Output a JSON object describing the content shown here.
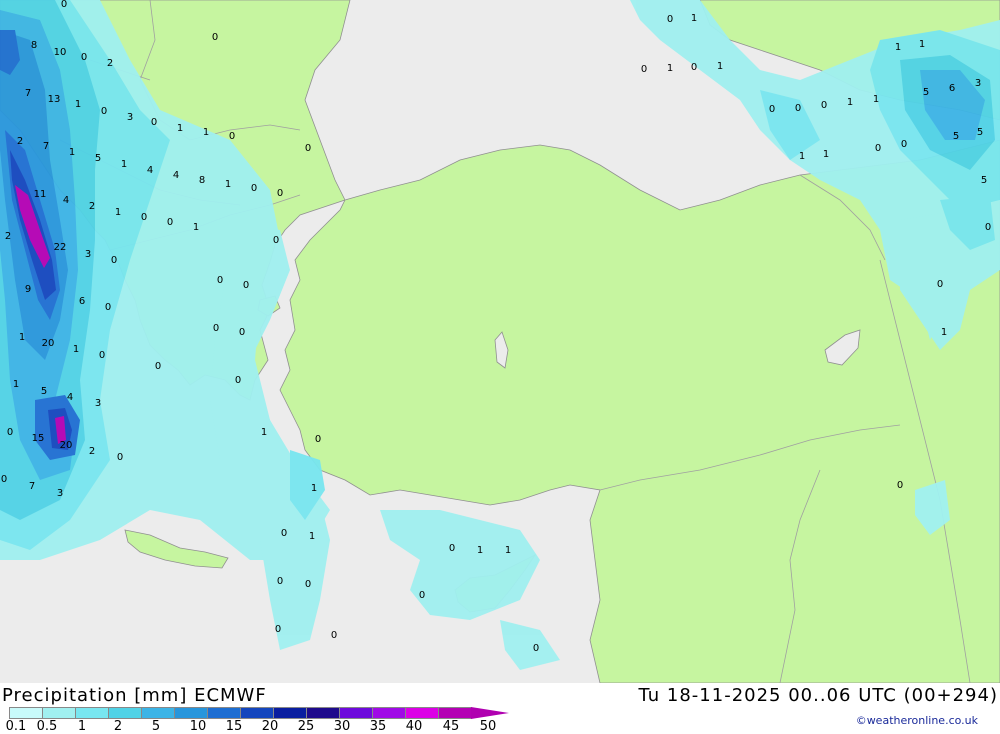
{
  "title_left": "Precipitation [mm] ECMWF",
  "title_right": "Tu 18-11-2025 00..06 UTC (00+294)",
  "credit": "©weatheronline.co.uk",
  "legend": {
    "ticks": [
      "0.1",
      "0.5",
      "1",
      "2",
      "5",
      "10",
      "15",
      "20",
      "25",
      "30",
      "35",
      "40",
      "45",
      "50"
    ],
    "colors": [
      "#c8fafa",
      "#a0f0f0",
      "#78e6f0",
      "#50d2e6",
      "#3cb4e6",
      "#2896dc",
      "#1e6ed2",
      "#1446be",
      "#0a1ea0",
      "#1e0a8c",
      "#6e0adc",
      "#a00ae6",
      "#dc00e6",
      "#b400b4"
    ]
  },
  "colors": {
    "land": "#c6f5a0",
    "sea": "#ececec",
    "border": "#a0a0a0",
    "coast": "#909090"
  },
  "map_values": [
    {
      "t": "0"
    },
    {
      "t": "0"
    },
    {
      "t": "8"
    },
    {
      "t": "10"
    },
    {
      "t": "0"
    },
    {
      "t": "2"
    },
    {
      "t": "7"
    },
    {
      "t": "13"
    },
    {
      "t": "1"
    },
    {
      "t": "0"
    },
    {
      "t": "3"
    },
    {
      "t": "0"
    },
    {
      "t": "1"
    },
    {
      "t": "1"
    },
    {
      "t": "0"
    },
    {
      "t": "2"
    },
    {
      "t": "7"
    },
    {
      "t": "1"
    },
    {
      "t": "5"
    },
    {
      "t": "1"
    },
    {
      "t": "4"
    },
    {
      "t": "4"
    },
    {
      "t": "8"
    },
    {
      "t": "1"
    },
    {
      "t": "0"
    },
    {
      "t": "0"
    },
    {
      "t": "11"
    },
    {
      "t": "4"
    },
    {
      "t": "2"
    },
    {
      "t": "1"
    },
    {
      "t": "0"
    },
    {
      "t": "0"
    },
    {
      "t": "1"
    },
    {
      "t": "0"
    },
    {
      "t": "2"
    },
    {
      "t": "22"
    },
    {
      "t": "3"
    },
    {
      "t": "0"
    },
    {
      "t": "9"
    },
    {
      "t": "6"
    },
    {
      "t": "0"
    },
    {
      "t": "0"
    },
    {
      "t": "0"
    },
    {
      "t": "0"
    },
    {
      "t": "0"
    },
    {
      "t": "1"
    },
    {
      "t": "20"
    },
    {
      "t": "1"
    },
    {
      "t": "0"
    },
    {
      "t": "0"
    },
    {
      "t": "1"
    },
    {
      "t": "5"
    },
    {
      "t": "4"
    },
    {
      "t": "3"
    },
    {
      "t": "0"
    },
    {
      "t": "0"
    },
    {
      "t": "15"
    },
    {
      "t": "20"
    },
    {
      "t": "2"
    },
    {
      "t": "0"
    },
    {
      "t": "1"
    },
    {
      "t": "0"
    },
    {
      "t": "0"
    },
    {
      "t": "7"
    },
    {
      "t": "3"
    },
    {
      "t": "1"
    },
    {
      "t": "0"
    },
    {
      "t": "1"
    },
    {
      "t": "0"
    },
    {
      "t": "0"
    },
    {
      "t": "0"
    },
    {
      "t": "1"
    },
    {
      "t": "1"
    },
    {
      "t": "0"
    },
    {
      "t": "0"
    },
    {
      "t": "0"
    },
    {
      "t": "0"
    },
    {
      "t": "0"
    },
    {
      "t": "1"
    },
    {
      "t": "0"
    },
    {
      "t": "1"
    },
    {
      "t": "0"
    },
    {
      "t": "1"
    },
    {
      "t": "0"
    },
    {
      "t": "0"
    },
    {
      "t": "0"
    },
    {
      "t": "1"
    },
    {
      "t": "1"
    },
    {
      "t": "5"
    },
    {
      "t": "6"
    },
    {
      "t": "3"
    },
    {
      "t": "5"
    },
    {
      "t": "5"
    },
    {
      "t": "0"
    },
    {
      "t": "0"
    },
    {
      "t": "1"
    },
    {
      "t": "1"
    },
    {
      "t": "5"
    },
    {
      "t": "0"
    },
    {
      "t": "0"
    },
    {
      "t": "1"
    },
    {
      "t": "0"
    },
    {
      "t": "1"
    },
    {
      "t": "1"
    },
    {
      "t": "0"
    }
  ]
}
